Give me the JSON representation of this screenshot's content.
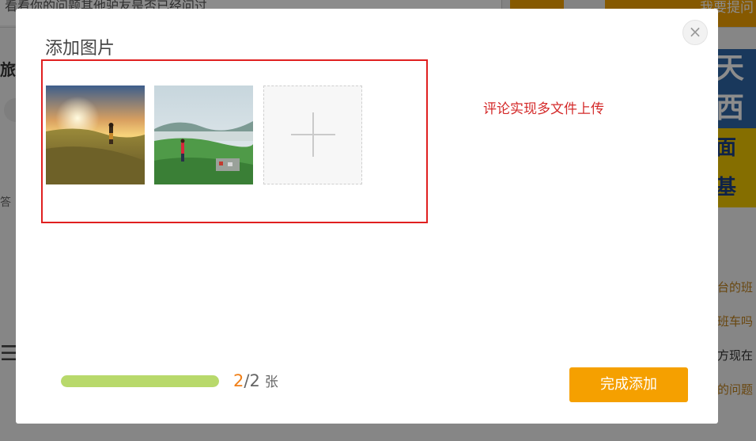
{
  "background": {
    "search_placeholder": "看看你的问题其他驴友是否已经问过",
    "ask_button": "我要提问",
    "left_label": "旅客",
    "left_small": "答",
    "right_banner": [
      "天",
      "西",
      "面基"
    ],
    "right_links": [
      "台的班",
      "班车吗",
      "方现在",
      "的问题"
    ]
  },
  "modal": {
    "title": "添加图片",
    "close_symbol": "×",
    "annotation": "评论实现多文件上传",
    "progress": {
      "current": "2",
      "separator": "/",
      "total": "2",
      "unit": "张",
      "fraction": 1.0
    },
    "finish_button": "完成添加"
  },
  "colors": {
    "accent": "#f5a000",
    "progress_fill": "#b8d96b",
    "annotation_red": "#e02020",
    "count_current": "#f07f17"
  }
}
